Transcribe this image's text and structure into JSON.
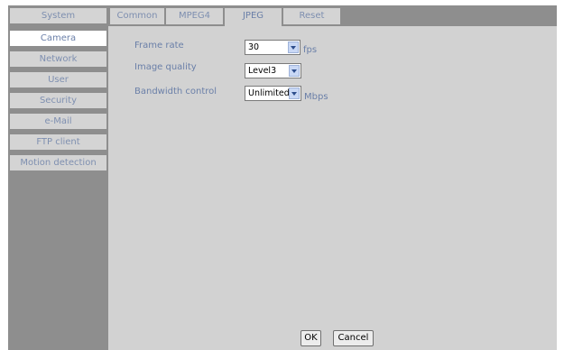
{
  "sidebar": {
    "items": [
      {
        "label": "System"
      },
      {
        "label": "Camera"
      },
      {
        "label": "Network"
      },
      {
        "label": "User"
      },
      {
        "label": "Security"
      },
      {
        "label": "e-Mail"
      },
      {
        "label": "FTP client"
      },
      {
        "label": "Motion detection"
      }
    ],
    "active": "Camera"
  },
  "tabs": [
    {
      "label": "Common"
    },
    {
      "label": "MPEG4"
    },
    {
      "label": "JPEG"
    },
    {
      "label": "Reset"
    }
  ],
  "active_tab": "JPEG",
  "form": {
    "frame_rate": {
      "label": "Frame rate",
      "value": "30",
      "unit": "fps"
    },
    "image_quality": {
      "label": "Image quality",
      "value": "Level3"
    },
    "bandwidth": {
      "label": "Bandwidth control",
      "value": "Unlimited",
      "unit": "Mbps"
    }
  },
  "buttons": {
    "ok": "OK",
    "cancel": "Cancel"
  },
  "colors": {
    "accent_text": "#6a7fa8",
    "sidebar_bg": "#8e8e8e",
    "panel_bg": "#d2d2d2"
  }
}
